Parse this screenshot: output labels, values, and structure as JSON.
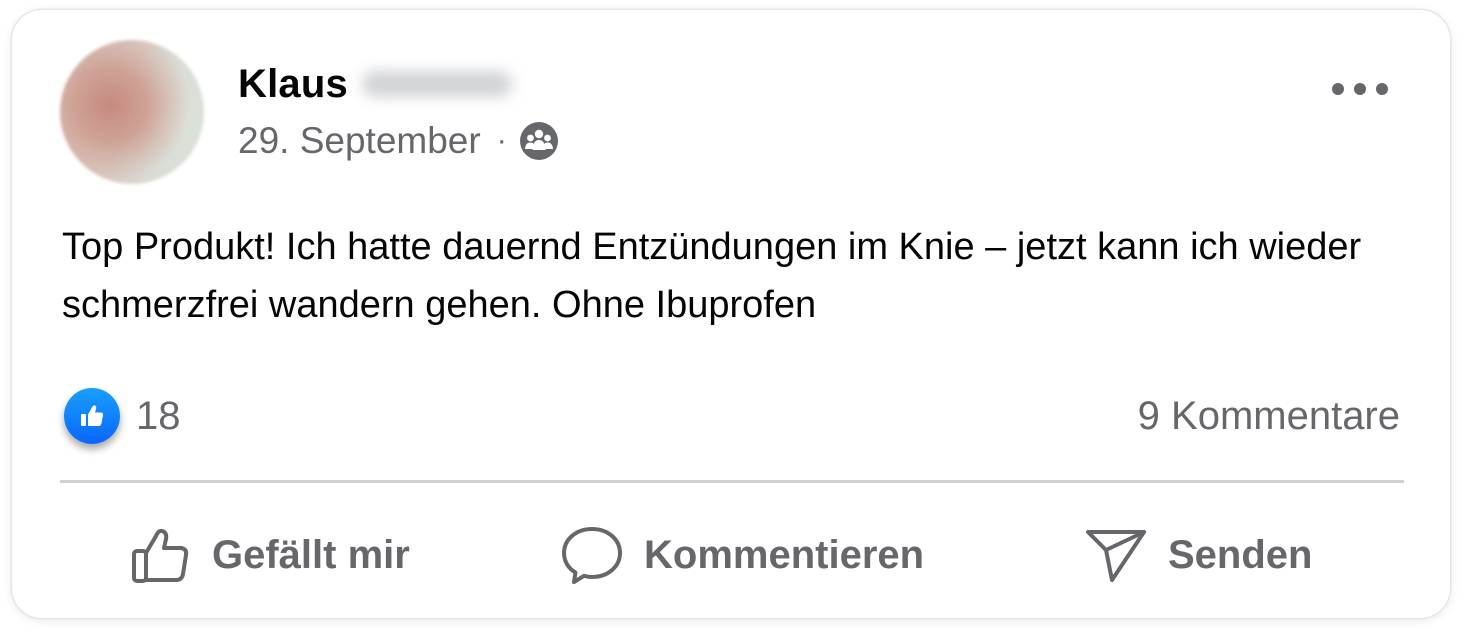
{
  "post": {
    "author": {
      "first_name": "Klaus",
      "last_name_obscured": true
    },
    "date": "29. September",
    "separator": "·",
    "audience_icon": "group-audience-icon",
    "more_icon": "more-options-icon",
    "text": "Top Produkt! Ich hatte dauernd Entzündungen im Knie – jetzt kann ich wieder schmerzfrei wandern gehen. Ohne Ibuprofen",
    "reactions": {
      "icon": "like-reaction-icon",
      "count": "18"
    },
    "comments_label": "9 Kommentare",
    "actions": [
      {
        "label": "Gefällt mir",
        "icon": "thumbs-up-icon"
      },
      {
        "label": "Kommentieren",
        "icon": "comment-bubble-icon"
      },
      {
        "label": "Senden",
        "icon": "send-icon"
      }
    ]
  },
  "colors": {
    "like_blue": "#0866ff",
    "secondary_text": "#65676b",
    "primary_text": "#050505",
    "divider": "#ced0d4"
  }
}
